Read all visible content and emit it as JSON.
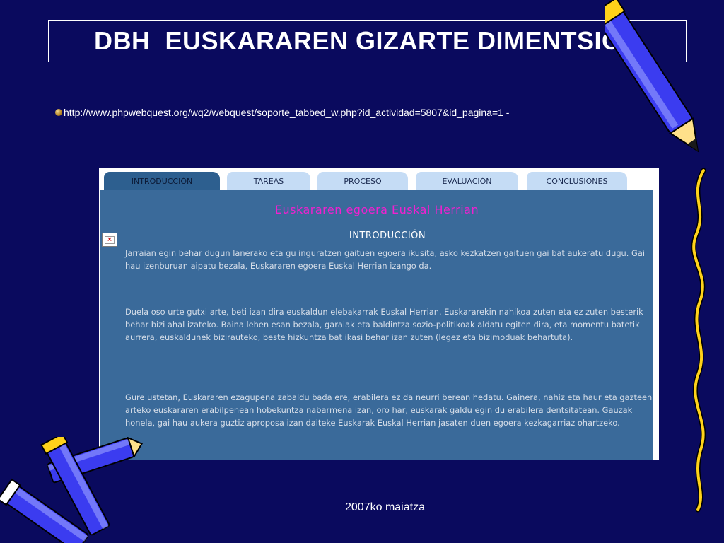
{
  "slide": {
    "title": "DBH  EUSKARAREN GIZARTE DIMENTSIOA",
    "link": "http://www.phpwebquest.org/wq2/webquest/soporte_tabbed_w.php?id_actividad=5807&id_pagina=1 -",
    "footer": "2007ko maiatza"
  },
  "webquest": {
    "tabs": [
      {
        "label": "INTRODUCCIÓN",
        "active": true
      },
      {
        "label": "TAREAS",
        "active": false
      },
      {
        "label": "PROCESO",
        "active": false
      },
      {
        "label": "EVALUACIÓN",
        "active": false
      },
      {
        "label": "CONCLUSIONES",
        "active": false
      }
    ],
    "heading": "Euskararen egoera Euskal Herrian",
    "section_title": "INTRODUCCIÓN",
    "close_glyph": "×",
    "paragraphs": [
      "Jarraian egin behar dugun lanerako eta gu inguratzen gaituen egoera ikusita, asko kezkatzen gaituen gai bat aukeratu dugu. Gai hau izenburuan aipatu bezala, Euskararen egoera Euskal Herrian izango da.",
      "Duela oso urte gutxi arte, beti izan dira euskaldun elebakarrak Euskal Herrian. Euskararekin nahikoa zuten eta ez zuten besterik behar bizi ahal izateko. Baina lehen esan bezala, garaiak eta baldintza sozio-politikoak aldatu egiten dira, eta momentu batetik aurrera, euskaldunek bizirauteko, beste hizkuntza bat ikasi behar izan zuten (legez eta bizimoduak behartuta).",
      "Gure ustetan, Euskararen ezagupena zabaldu bada ere, erabilera ez da neurri berean hedatu. Gainera, nahiz eta haur eta gazteen arteko euskararen erabilpenean hobekuntza nabarmena izan, oro har, euskarak galdu egin du erabilera dentsitatean. Gauzak honela, gai hau aukera guztiz aproposa izan daiteke Euskarak Euskal Herrian jasaten duen egoera kezkagarriaz ohartzeko."
    ]
  },
  "colors": {
    "background": "#0a0a5e",
    "panel": "#3a6a9a",
    "heading_accent": "#f020d0",
    "tab_idle": "#c5dcf5",
    "tab_active": "#2d5f8f"
  },
  "icons": [
    "bullet-icon",
    "pencil-top-right-icon",
    "pencil-bottom-left-icon",
    "squiggle-line-icon",
    "close-icon"
  ]
}
